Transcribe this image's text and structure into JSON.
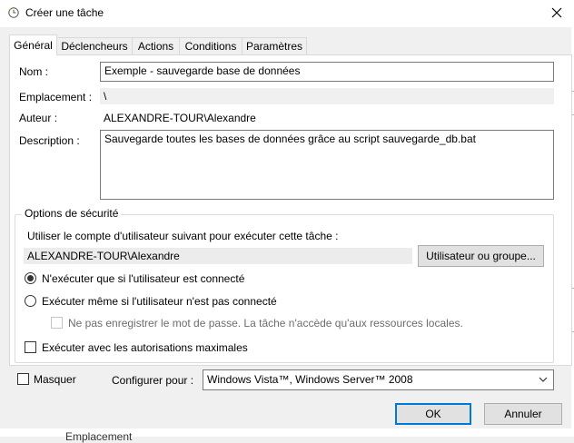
{
  "window": {
    "title": "Créer une tâche",
    "icon": "clock-icon"
  },
  "tabs": [
    {
      "label": "Général",
      "active": true
    },
    {
      "label": "Déclencheurs",
      "active": false
    },
    {
      "label": "Actions",
      "active": false
    },
    {
      "label": "Conditions",
      "active": false
    },
    {
      "label": "Paramètres",
      "active": false
    }
  ],
  "general": {
    "name_label": "Nom :",
    "name_value": "Exemple - sauvegarde base de données",
    "location_label": "Emplacement :",
    "location_value": "\\",
    "author_label": "Auteur :",
    "author_value": "ALEXANDRE-TOUR\\Alexandre",
    "description_label": "Description :",
    "description_value": "Sauvegarde toutes les bases de données grâce au script sauvegarde_db.bat"
  },
  "security": {
    "title": "Options de sécurité",
    "account_prompt": "Utiliser le compte d'utilisateur suivant pour exécuter cette tâche :",
    "account_value": "ALEXANDRE-TOUR\\Alexandre",
    "user_group_button": "Utilisateur ou groupe...",
    "radio_logged_on": "N'exécuter que si l'utilisateur est connecté",
    "radio_any": "Exécuter même si l'utilisateur n'est pas connecté",
    "no_store_password": "Ne pas enregistrer le mot de passe. La tâche n'accède qu'aux ressources locales.",
    "highest_privileges": "Exécuter avec les autorisations maximales",
    "selected_radio": "logged_on"
  },
  "footer": {
    "hide_label": "Masquer",
    "configure_label": "Configurer pour :",
    "configure_value": "Windows Vista™, Windows Server™ 2008",
    "ok_label": "OK",
    "cancel_label": "Annuler"
  },
  "background_text": "Emplacement",
  "colors": {
    "accent": "#0078d7",
    "panel": "#ffffff",
    "window": "#f0f0f0"
  }
}
